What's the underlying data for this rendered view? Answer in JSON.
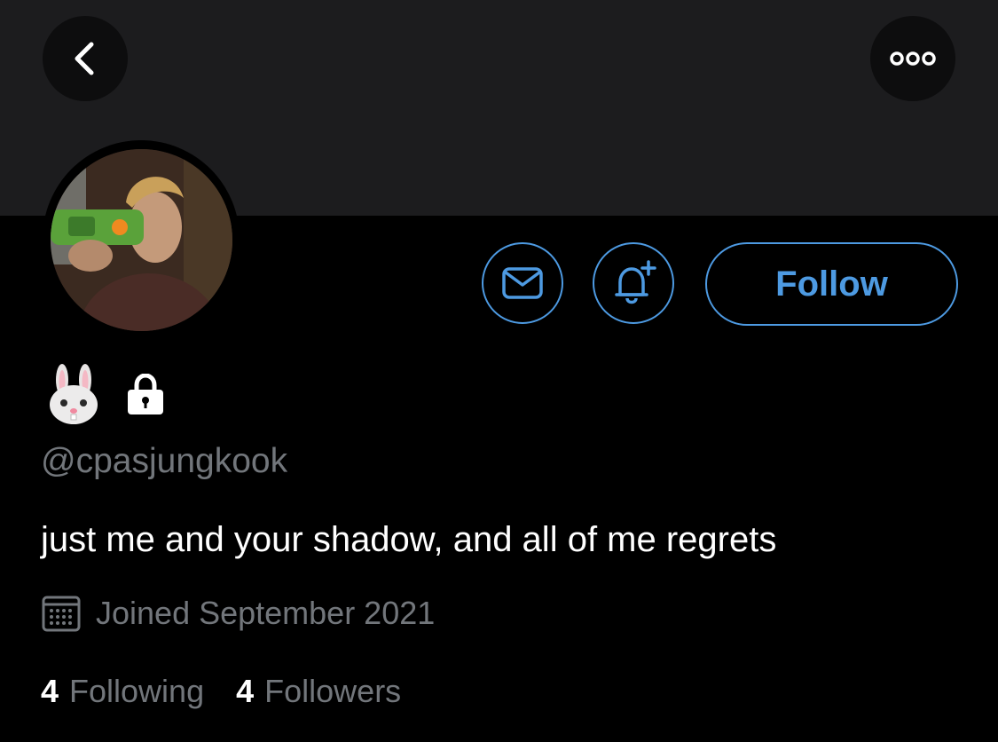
{
  "header": {
    "back_icon": "chevron-left-icon",
    "more_icon": "ellipsis-icon"
  },
  "profile": {
    "avatar_description": "profile photo",
    "display_name_emoji": "🐰",
    "protected_icon": "lock-icon",
    "handle": "@cpasjungkook",
    "bio": "just me and your shadow, and all of me regrets",
    "joined": "Joined September 2021"
  },
  "actions": {
    "message_icon": "envelope-icon",
    "notify_icon": "bell-plus-icon",
    "follow_label": "Follow"
  },
  "stats": {
    "following_count": "4",
    "following_label": "Following",
    "followers_count": "4",
    "followers_label": "Followers"
  },
  "colors": {
    "accent": "#4d9ae2",
    "muted_text": "#72767b",
    "banner": "#1c1c1e",
    "background": "#000000"
  }
}
